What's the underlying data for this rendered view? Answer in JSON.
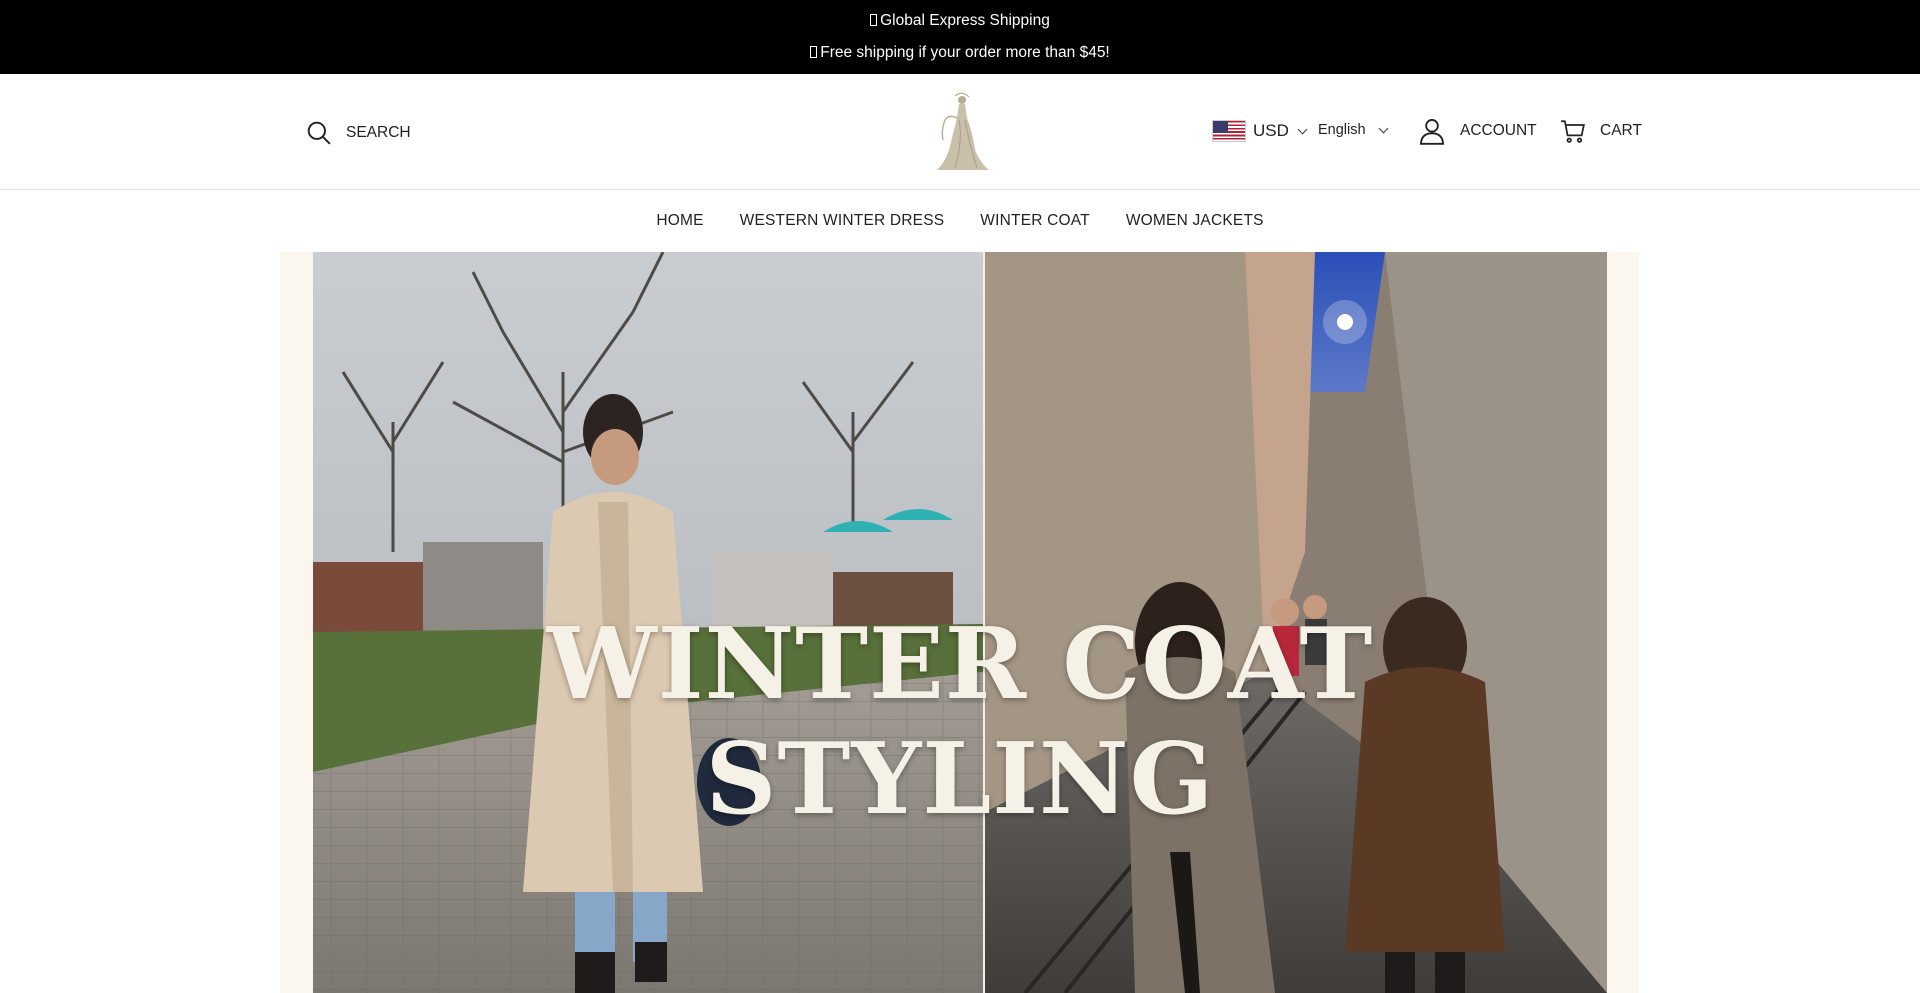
{
  "announcement": {
    "line1": "Global Express Shipping",
    "line2": "Free shipping if your order more than $45!"
  },
  "header": {
    "search_label": "SEARCH",
    "currency": "USD",
    "language": "English",
    "account_label": "ACCOUNT",
    "cart_label": "CART"
  },
  "nav": {
    "items": [
      "HOME",
      "WESTERN WINTER DRESS",
      "WINTER COAT",
      "WOMEN JACKETS"
    ]
  },
  "hero": {
    "title": "WINTER COAT STYLING"
  },
  "icons": {
    "search": "search-icon",
    "logo": "brand-logo",
    "flag": "us-flag-icon",
    "account": "user-icon",
    "cart": "cart-icon"
  },
  "colors": {
    "topbar_bg": "#000000",
    "topbar_text": "#ffffff",
    "hero_bg": "#fbf7ef",
    "hero_title": "#f6f1e6"
  }
}
